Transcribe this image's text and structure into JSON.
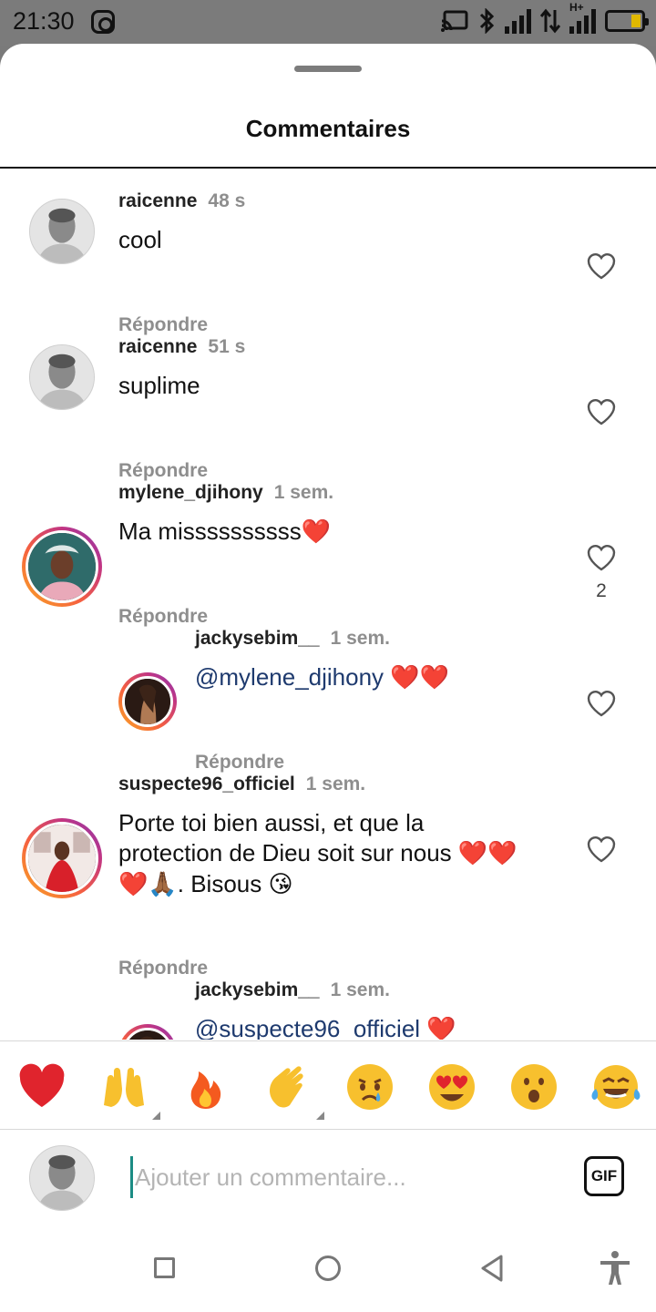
{
  "status_bar": {
    "time": "21:30",
    "icons": [
      "instagram-icon",
      "cast-icon",
      "bluetooth-icon",
      "signal-icon",
      "data-arrows-icon",
      "signal-hplus-icon",
      "battery-icon"
    ],
    "network_label": "H+",
    "battery_level": 0.25,
    "battery_color": "#e0b800"
  },
  "sheet": {
    "title": "Commentaires"
  },
  "comments": [
    {
      "username": "raicenne",
      "time": "48 s",
      "text": "cool",
      "reply_label": "Répondre",
      "likes": ""
    },
    {
      "username": "raicenne",
      "time": "51 s",
      "text": "suplime",
      "reply_label": "Répondre",
      "likes": ""
    },
    {
      "username": "mylene_djihony",
      "time": "1 sem.",
      "text": "Ma missssssssss",
      "text_emoji": "❤️",
      "reply_label": "Répondre",
      "likes": "2"
    },
    {
      "username": "jackysebim__",
      "time": "1 sem.",
      "mention": "@mylene_djihony",
      "text_emoji": "❤️❤️",
      "reply_label": "Répondre",
      "likes": ""
    },
    {
      "username": "suspecte96_officiel",
      "time": "1 sem.",
      "text_line1": "Porte toi bien aussi, et que la",
      "text_line2": "protection de Dieu soit sur nous",
      "line2_emoji": "❤️❤️",
      "line3_emoji_a": "❤️🙏🏾",
      "text_line3": ". Bisous",
      "line3_emoji_b": "😘",
      "reply_label": "Répondre",
      "likes": ""
    },
    {
      "username": "jackysebim__",
      "time": "1 sem.",
      "mention": "@suspecte96_officiel",
      "text_emoji": "❤️",
      "reply_label": "",
      "likes": ""
    }
  ],
  "emoji_bar": {
    "emojis": [
      "❤️",
      "🙌",
      "🔥",
      "👏",
      "😢",
      "😍",
      "😮",
      "😂"
    ]
  },
  "composer": {
    "placeholder": "Ajouter un commentaire...",
    "gif_label": "GIF"
  },
  "colors": {
    "accent": "#1c8c84",
    "mention": "#1e3a6e",
    "muted": "#8e8e8e",
    "heart_red": "#e0242d"
  }
}
